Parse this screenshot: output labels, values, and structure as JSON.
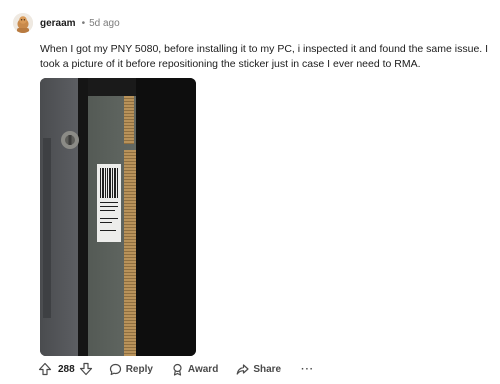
{
  "comment": {
    "author": "geraam",
    "separator": "•",
    "time_ago": "5d ago",
    "text": "When I got my PNY 5080, before installing it to my PC, i inspected it and found the same issue. I took a picture of it before repositioning the sticker just in case I ever need to RMA.",
    "image_description_icon": "gpu-pcie-connector-photo",
    "sticker_lines": [
      "PNY",
      "CV30-RTX5080-GHG"
    ]
  },
  "actions": {
    "upvote_icon": "arrow-up-icon",
    "vote_count": "288",
    "downvote_icon": "arrow-down-icon",
    "reply_label": "Reply",
    "award_label": "Award",
    "share_label": "Share",
    "more_label": "···"
  },
  "colors": {
    "text": "#1c1c1c",
    "muted": "#7c7c7c",
    "action": "#4a4a4a"
  }
}
